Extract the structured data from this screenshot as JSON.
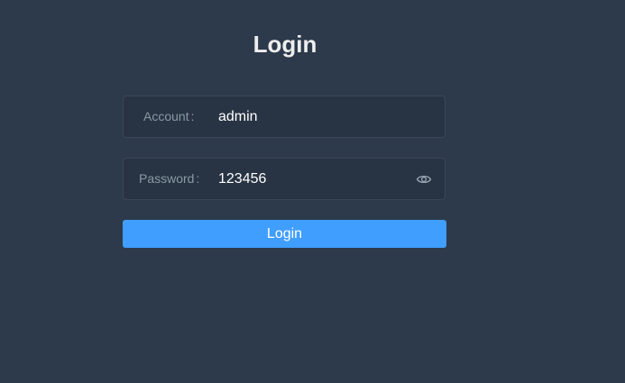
{
  "page": {
    "title": "Login"
  },
  "form": {
    "account": {
      "label": "Account",
      "colon": ":",
      "value": "admin"
    },
    "password": {
      "label": "Password",
      "colon": ":",
      "value": "123456",
      "toggle_icon": "eye-icon"
    },
    "submit_label": "Login"
  },
  "colors": {
    "background": "#2d3a4b",
    "input_background": "#283443",
    "primary": "#409eff",
    "label": "#889aa4"
  }
}
